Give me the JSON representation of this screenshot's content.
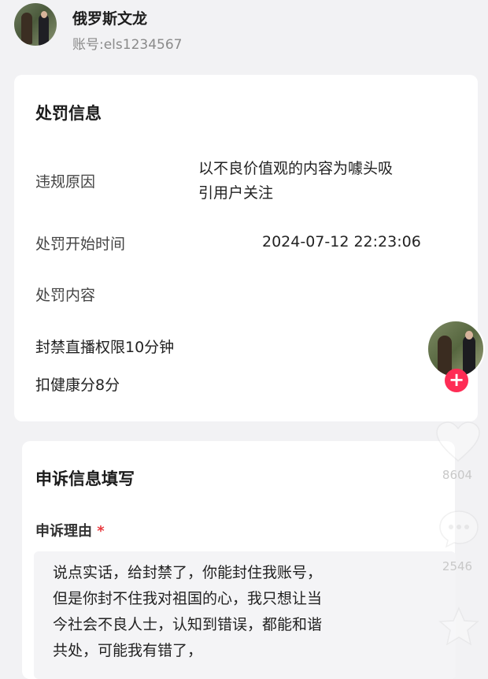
{
  "profile": {
    "name": "俄罗斯文龙",
    "account": "账号:els1234567"
  },
  "penalty": {
    "title": "处罚信息",
    "reason_label": "违规原因",
    "reason_line1": "以不良价值观的内容为噱头吸",
    "reason_line2": "引用户关注",
    "start_label": "处罚开始时间",
    "start_value": "2024-07-12  22:23:06",
    "content_label": "处罚内容",
    "content_item1": "封禁直播权限10分钟",
    "content_item2": "扣健康分8分"
  },
  "appeal": {
    "title": "申诉信息填写",
    "reason_label": "申诉理由",
    "required_mark": "*",
    "text_line1": "说点实话，给封禁了，你能封住我账号，",
    "text_line2": "但是你封不住我对祖国的心，我只想让当",
    "text_line3": "今社会不良人士，认知到错误，都能和谐",
    "text_line4": "共处，可能我有错了，"
  },
  "side": {
    "plus": "+",
    "like_count": "8604",
    "comment_count": "2546"
  },
  "icons": [
    "heart-icon",
    "comment-icon",
    "star-icon",
    "plus-icon"
  ],
  "colors": {
    "accent": "#fe2c55",
    "required": "#e8383d",
    "background": "#f2f2f4"
  }
}
